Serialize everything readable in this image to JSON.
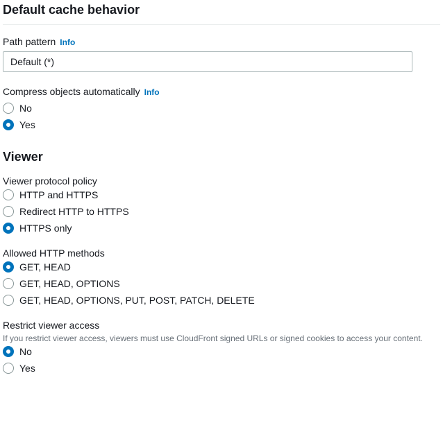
{
  "section": {
    "title": "Default cache behavior"
  },
  "path_pattern": {
    "label": "Path pattern",
    "info": "Info",
    "value": "Default (*)"
  },
  "compress": {
    "label": "Compress objects automatically",
    "info": "Info",
    "options": [
      "No",
      "Yes"
    ],
    "selected": 1
  },
  "viewer": {
    "title": "Viewer"
  },
  "protocol_policy": {
    "label": "Viewer protocol policy",
    "options": [
      "HTTP and HTTPS",
      "Redirect HTTP to HTTPS",
      "HTTPS only"
    ],
    "selected": 2
  },
  "http_methods": {
    "label": "Allowed HTTP methods",
    "options": [
      "GET, HEAD",
      "GET, HEAD, OPTIONS",
      "GET, HEAD, OPTIONS, PUT, POST, PATCH, DELETE"
    ],
    "selected": 0
  },
  "restrict_access": {
    "label": "Restrict viewer access",
    "help": "If you restrict viewer access, viewers must use CloudFront signed URLs or signed cookies to access your content.",
    "options": [
      "No",
      "Yes"
    ],
    "selected": 0
  }
}
